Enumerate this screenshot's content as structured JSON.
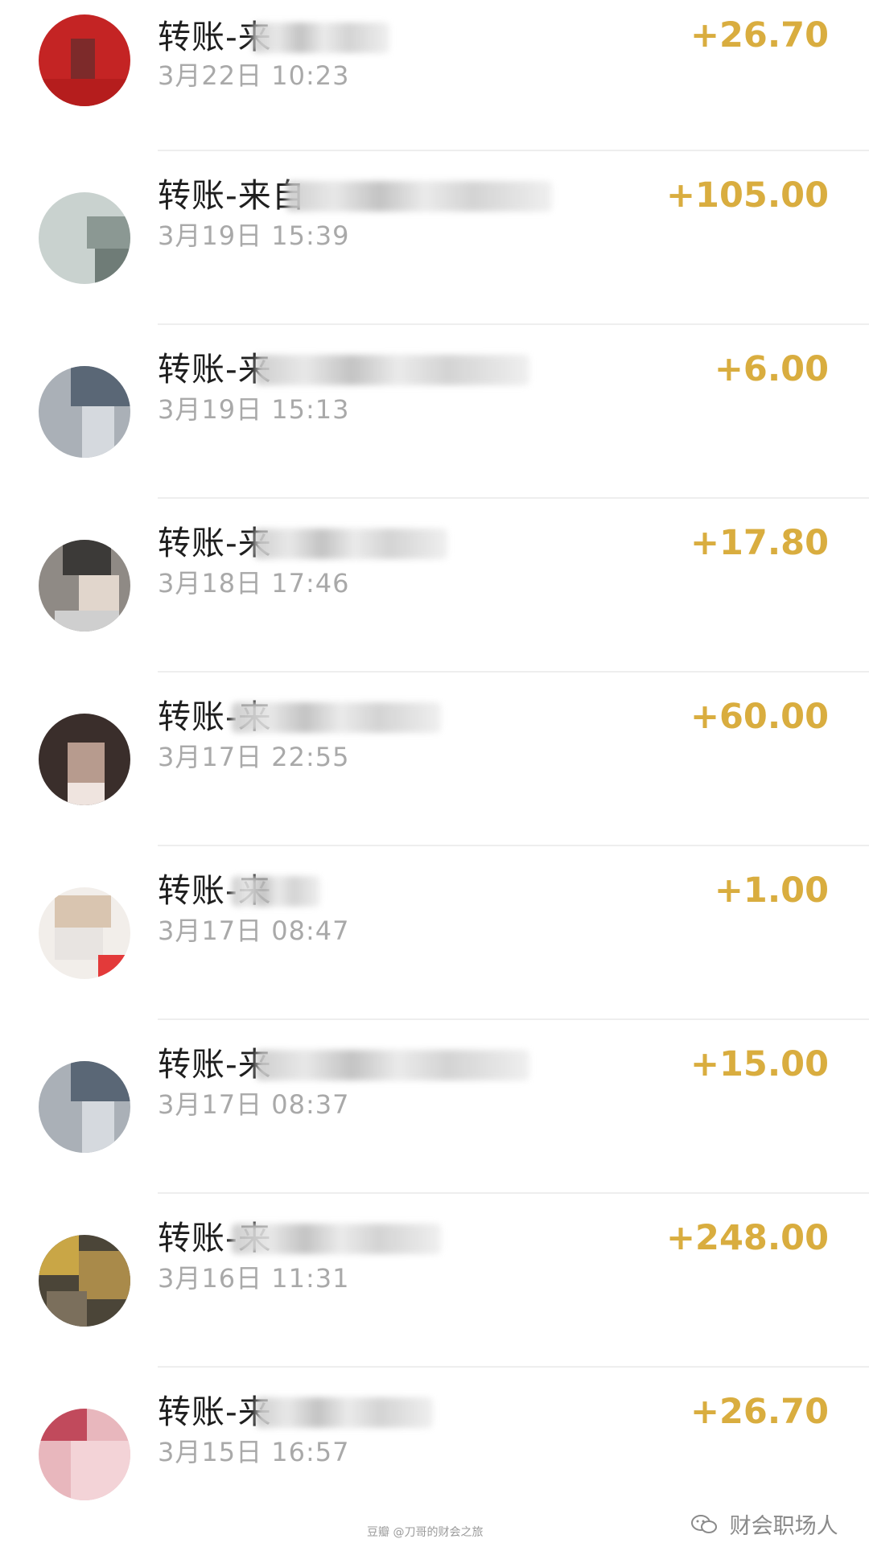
{
  "transactions": [
    {
      "title": "转账-来",
      "date": "3月22日 10:23",
      "amount": "+26.70"
    },
    {
      "title": "转账-来自",
      "date": "3月19日 15:39",
      "amount": "+105.00"
    },
    {
      "title": "转账-来",
      "date": "3月19日 15:13",
      "amount": "+6.00"
    },
    {
      "title": "转账-来",
      "date": "3月18日 17:46",
      "amount": "+17.80"
    },
    {
      "title": "转账-来",
      "date": "3月17日 22:55",
      "amount": "+60.00"
    },
    {
      "title": "转账-来",
      "date": "3月17日 08:47",
      "amount": "+1.00"
    },
    {
      "title": "转账-来",
      "date": "3月17日 08:37",
      "amount": "+15.00"
    },
    {
      "title": "转账-来",
      "date": "3月16日 11:31",
      "amount": "+248.00"
    },
    {
      "title": "转账-来",
      "date": "3月15日 16:57",
      "amount": "+26.70"
    }
  ],
  "watermark": {
    "label": "财会职场人",
    "icon": "wechat-icon"
  },
  "source_label": "豆瓣 @刀哥的财会之旅",
  "colors": {
    "amount": "#d9ad3f",
    "date": "#a9a9a9",
    "title": "#1f1f1f"
  }
}
